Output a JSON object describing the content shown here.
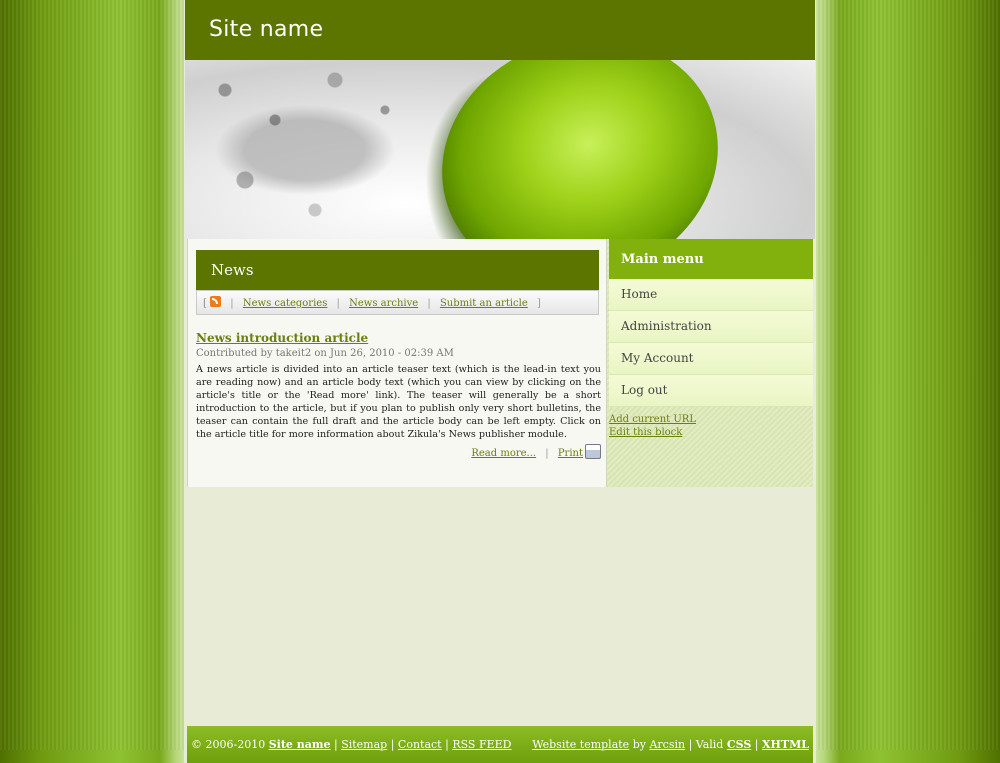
{
  "header": {
    "site_name": "Site name"
  },
  "news": {
    "title": "News",
    "links": [
      "News categories",
      "News archive",
      "Submit an article"
    ]
  },
  "article": {
    "title": "News introduction article",
    "meta": "Contributed by takeit2 on Jun 26, 2010 - 02:39 AM",
    "body": "A news article is divided into an article teaser text (which is the lead-in text you are reading now) and an article body text (which you can view by clicking on the article's title or the 'Read more' link). The teaser will generally be a short introduction to the article, but if you plan to publish only very short bulletins, the teaser can contain the full draft and the article body can be left empty. Click on the article title for more information about Zikula's News publisher module.",
    "read_more": "Read more...",
    "print": "Print"
  },
  "sidebar": {
    "title": "Main menu",
    "items": [
      "Home",
      "Administration",
      "My Account",
      "Log out"
    ],
    "links": [
      "Add current URL",
      "Edit this block"
    ]
  },
  "footer": {
    "copyright": "© 2006-2010",
    "site_name": "Site name",
    "links": [
      "Sitemap",
      "Contact",
      "RSS FEED"
    ],
    "template_link": "Website template",
    "by": "by",
    "author": "Arcsin",
    "valid": "Valid",
    "css": "CSS",
    "xhtml": "XHTML"
  },
  "colors": {
    "header": "#5c7500",
    "accent": "#82b00c",
    "link": "#6b7f0e"
  }
}
